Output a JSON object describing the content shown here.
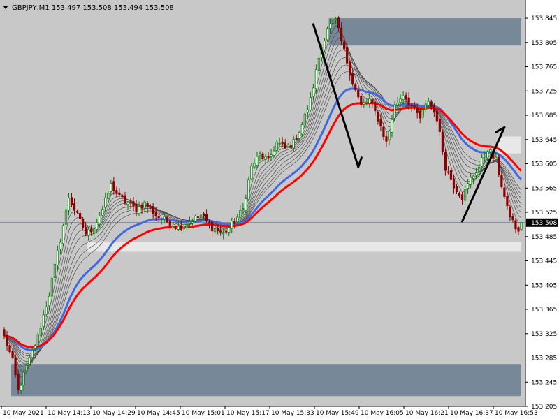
{
  "header": {
    "symbol_line": "GBPJPY,M1  153.497 153.508 153.494 153.508"
  },
  "colors": {
    "background": "#c8c8c8",
    "axis_panel": "#ffffff",
    "bull_candle": "#008000",
    "bear_candle": "#8b0000",
    "ema_blue": "#4169e1",
    "ema_red": "#ff0000",
    "ema_thin": "#404040",
    "zone_dark": "#778899",
    "zone_light": "#e8e8e8",
    "price_line": "#6b7f99",
    "annotation": "#000000"
  },
  "chart_data": {
    "type": "candlestick",
    "symbol": "GBPJPY",
    "timeframe": "M1",
    "ohlc_header": {
      "open": 153.497,
      "high": 153.508,
      "low": 153.494,
      "close": 153.508
    },
    "current_price": 153.508,
    "current_price_label": "153.508",
    "y_range": [
      153.205,
      153.875
    ],
    "y_ticks": [
      "153.845",
      "153.805",
      "153.765",
      "153.725",
      "153.685",
      "153.645",
      "153.605",
      "153.565",
      "153.525",
      "153.485",
      "153.445",
      "153.405",
      "153.365",
      "153.325",
      "153.285",
      "153.245",
      "153.205"
    ],
    "x_labels": [
      "10 May 2021",
      "10 May 14:13",
      "10 May 14:29",
      "10 May 14:45",
      "10 May 15:01",
      "10 May 15:17",
      "10 May 15:33",
      "10 May 15:49",
      "10 May 16:05",
      "10 May 16:21",
      "10 May 16:37",
      "10 May 16:53"
    ],
    "bar_count": 185,
    "close_anchors": [
      [
        0,
        153.32
      ],
      [
        3,
        153.28
      ],
      [
        5,
        153.23
      ],
      [
        8,
        153.27
      ],
      [
        12,
        153.32
      ],
      [
        16,
        153.39
      ],
      [
        20,
        153.48
      ],
      [
        23,
        153.55
      ],
      [
        26,
        153.52
      ],
      [
        29,
        153.49
      ],
      [
        32,
        153.5
      ],
      [
        35,
        153.53
      ],
      [
        38,
        153.57
      ],
      [
        41,
        153.55
      ],
      [
        44,
        153.54
      ],
      [
        47,
        153.53
      ],
      [
        50,
        153.54
      ],
      [
        54,
        153.52
      ],
      [
        58,
        153.51
      ],
      [
        62,
        153.5
      ],
      [
        66,
        153.51
      ],
      [
        70,
        153.52
      ],
      [
        74,
        153.5
      ],
      [
        78,
        153.49
      ],
      [
        82,
        153.51
      ],
      [
        85,
        153.53
      ],
      [
        88,
        153.6
      ],
      [
        91,
        153.62
      ],
      [
        94,
        153.61
      ],
      [
        97,
        153.64
      ],
      [
        100,
        153.63
      ],
      [
        103,
        153.64
      ],
      [
        106,
        153.67
      ],
      [
        109,
        153.71
      ],
      [
        112,
        153.78
      ],
      [
        115,
        153.83
      ],
      [
        118,
        153.84
      ],
      [
        121,
        153.79
      ],
      [
        124,
        153.74
      ],
      [
        127,
        153.7
      ],
      [
        130,
        153.71
      ],
      [
        133,
        153.68
      ],
      [
        136,
        153.64
      ],
      [
        139,
        153.7
      ],
      [
        142,
        153.72
      ],
      [
        145,
        153.7
      ],
      [
        148,
        153.68
      ],
      [
        151,
        153.71
      ],
      [
        154,
        153.68
      ],
      [
        157,
        153.6
      ],
      [
        160,
        153.57
      ],
      [
        163,
        153.55
      ],
      [
        166,
        153.58
      ],
      [
        169,
        153.6
      ],
      [
        172,
        153.63
      ],
      [
        175,
        153.61
      ],
      [
        177,
        153.57
      ],
      [
        179,
        153.53
      ],
      [
        181,
        153.51
      ],
      [
        183,
        153.49
      ],
      [
        184,
        153.508
      ]
    ],
    "indicators": [
      {
        "type": "EMA",
        "color": "blue"
      },
      {
        "type": "EMA",
        "color": "red"
      },
      {
        "type": "EMA",
        "color": "gray",
        "count": 8
      }
    ],
    "zones": [
      {
        "kind": "supply",
        "price_top": 153.845,
        "price_bottom": 153.8,
        "bar_start": 116,
        "bar_end": 184
      },
      {
        "kind": "demand",
        "price_top": 153.275,
        "price_bottom": 153.222,
        "bar_start": 3,
        "bar_end": 184
      },
      {
        "kind": "light",
        "price_top": 153.476,
        "price_bottom": 153.46,
        "bar_start": 30,
        "bar_end": 184
      },
      {
        "kind": "light",
        "price_top": 153.65,
        "price_bottom": 153.622,
        "bar_start": 176,
        "bar_end": 184
      }
    ],
    "annotations": [
      {
        "type": "arrow",
        "direction": "down",
        "from": {
          "bar": 110,
          "price": 153.835
        },
        "to": {
          "bar": 126,
          "price": 153.6
        }
      },
      {
        "type": "arrow",
        "direction": "up",
        "from": {
          "bar": 163,
          "price": 153.51
        },
        "to": {
          "bar": 178,
          "price": 153.665
        }
      }
    ],
    "grid": false
  }
}
